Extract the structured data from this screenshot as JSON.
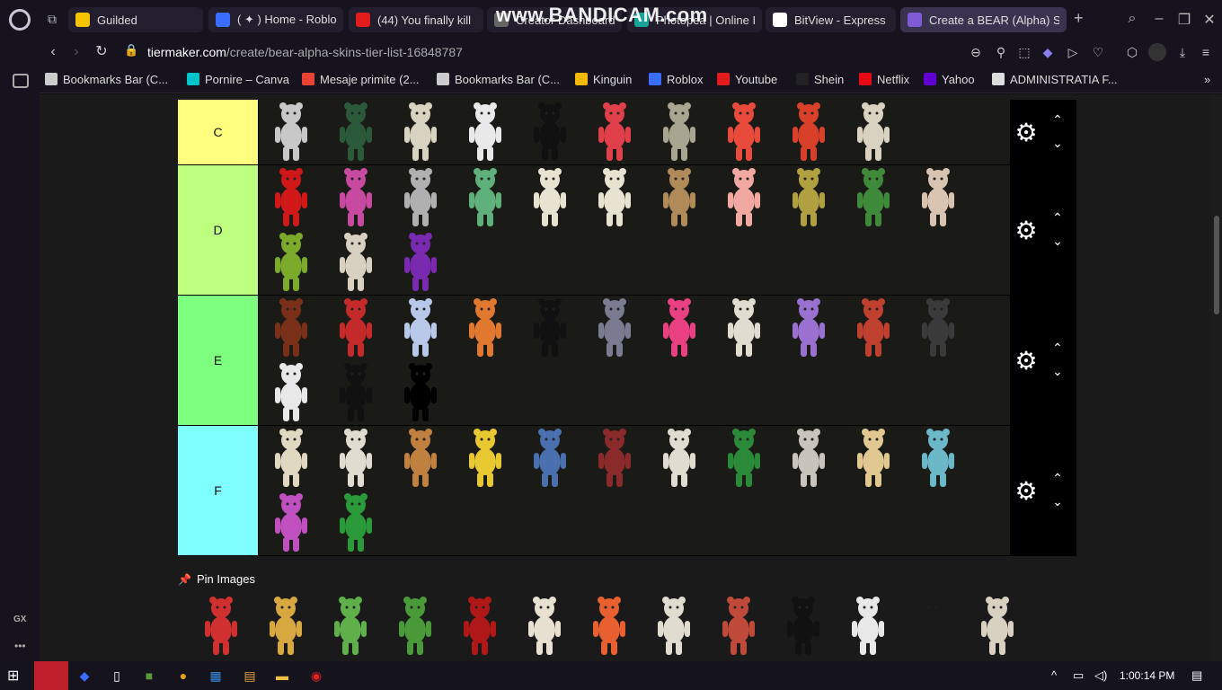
{
  "browser": {
    "watermark": "www.BANDICAM.com",
    "tabs": [
      {
        "label": "Guilded",
        "color": "#f5c400"
      },
      {
        "label": "( ✦ ) Home - Roblo",
        "color": "#3a6cff"
      },
      {
        "label": "(44) You finally kill",
        "color": "#e21b1b"
      },
      {
        "label": "Creator Dashboard",
        "color": "#666666"
      },
      {
        "label": "Photopea | Online I",
        "color": "#18a497"
      },
      {
        "label": "BitView - Express",
        "color": "#ffffff"
      },
      {
        "label": "Create a BEAR (Alpha) Sk",
        "color": "#7f5bd6"
      }
    ],
    "url_host": "tiermaker.com",
    "url_path": "/create/bear-alpha-skins-tier-list-16848787",
    "bookmarks": [
      {
        "label": "Bookmarks Bar (C...",
        "color": "#cccccc"
      },
      {
        "label": "Pornire – Canva",
        "color": "#00c4cc"
      },
      {
        "label": "Mesaje primite (2...",
        "color": "#ea4335"
      },
      {
        "label": "Bookmarks Bar (C...",
        "color": "#cccccc"
      },
      {
        "label": "Kinguin",
        "color": "#f5b800"
      },
      {
        "label": "Roblox",
        "color": "#3a6cff"
      },
      {
        "label": "Youtube",
        "color": "#e21b1b"
      },
      {
        "label": "Shein",
        "color": "#222222"
      },
      {
        "label": "Netflix",
        "color": "#e50914"
      },
      {
        "label": "Yahoo",
        "color": "#6001d2"
      },
      {
        "label": "ADMINISTRATIA F...",
        "color": "#dddddd"
      }
    ],
    "sidebar_gx": "GX",
    "sidebar_more": "•••"
  },
  "tiers": [
    {
      "label": "C",
      "color": "#ffff7f",
      "rows": 1,
      "items": [
        "#c8c8c8",
        "#2b5a3b",
        "#d8d2c0",
        "#e9e9e9",
        "#111111",
        "#e0404a",
        "#a8a690",
        "#e84a3c",
        "#d8402a",
        "#d9d2c0"
      ]
    },
    {
      "label": "D",
      "color": "#bfff7f",
      "rows": 2,
      "items": [
        "#d01818",
        "#c84aa0",
        "#b0b0b0",
        "#5fb07a",
        "#e8e2d0",
        "#e8e2d0",
        "#b08a58",
        "#f0a8a0",
        "#b0a040",
        "#3f8a3a",
        "#d8c4b0",
        "#7caa2a",
        "#d8d0c0",
        "#7a2ab0"
      ]
    },
    {
      "label": "E",
      "color": "#7fff7f",
      "rows": 2,
      "items": [
        "#7a3018",
        "#c42a2a",
        "#b8c8e8",
        "#e07830",
        "#111111",
        "#7a7a90",
        "#e84080",
        "#e0dcd0",
        "#9a70d0",
        "#c04030",
        "#3a3a3a",
        "#e8e8e8",
        "#111111",
        "#000000"
      ]
    },
    {
      "label": "F",
      "color": "#7fffff",
      "rows": 2,
      "items": [
        "#e0d8c0",
        "#e0dcd0",
        "#c08040",
        "#e8c830",
        "#4a70b0",
        "#8a2a2a",
        "#e0dcd0",
        "#2a8a3a",
        "#c8c4bc",
        "#e0c890",
        "#6ab8c8",
        "#c050c0",
        "#2a9a3a"
      ]
    }
  ],
  "pin": {
    "title": "Pin Images",
    "items": [
      "#d03030",
      "#d8a840",
      "#5fb04a",
      "#4a9a3a",
      "#b01818",
      "#e8e0d0",
      "#e86030",
      "#e0dcd0",
      "#c04a3a",
      "#111111",
      "#e8e8e8",
      "#1a1a1a",
      "#d8d0c0"
    ]
  },
  "taskbar": {
    "clock": "1:00:14 PM"
  }
}
